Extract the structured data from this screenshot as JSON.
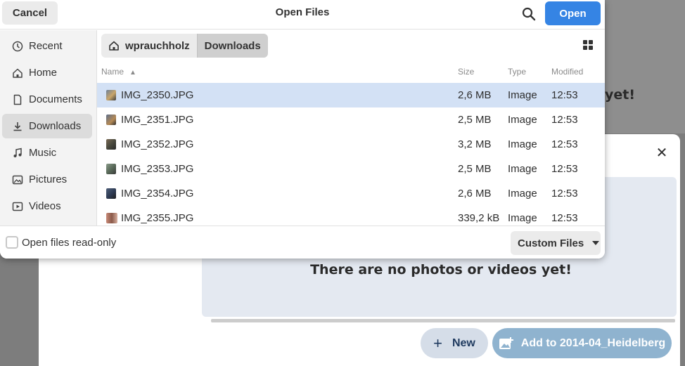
{
  "background_app": {
    "heading_fragment": "yet!",
    "empty_message": "There are no photos or videos yet!",
    "new_button_label": "New",
    "add_button_label": "Add to 2014-04_Heidelberg",
    "close_icon": "close-icon",
    "accent_color": "#8fb3cf"
  },
  "dialog": {
    "title": "Open Files",
    "cancel_label": "Cancel",
    "open_label": "Open",
    "search_icon": "search-icon",
    "accent_color": "#3584e4"
  },
  "sidebar": {
    "items": [
      {
        "label": "Recent",
        "icon": "clock-icon"
      },
      {
        "label": "Home",
        "icon": "home-icon"
      },
      {
        "label": "Documents",
        "icon": "document-icon"
      },
      {
        "label": "Downloads",
        "icon": "download-icon",
        "active": true
      },
      {
        "label": "Music",
        "icon": "music-icon"
      },
      {
        "label": "Pictures",
        "icon": "image-icon"
      },
      {
        "label": "Videos",
        "icon": "video-icon"
      }
    ]
  },
  "pathbar": {
    "home_label": "wprauchholz",
    "current_label": "Downloads",
    "view_toggle_icon": "grid-view-icon"
  },
  "columns": {
    "name": "Name",
    "size": "Size",
    "type": "Type",
    "modified": "Modified"
  },
  "files": [
    {
      "name": "IMG_2350.JPG",
      "size": "2,6 MB",
      "type": "Image",
      "modified": "12:53",
      "selected": true
    },
    {
      "name": "IMG_2351.JPG",
      "size": "2,5 MB",
      "type": "Image",
      "modified": "12:53"
    },
    {
      "name": "IMG_2352.JPG",
      "size": "3,2 MB",
      "type": "Image",
      "modified": "12:53"
    },
    {
      "name": "IMG_2353.JPG",
      "size": "2,5 MB",
      "type": "Image",
      "modified": "12:53"
    },
    {
      "name": "IMG_2354.JPG",
      "size": "2,6 MB",
      "type": "Image",
      "modified": "12:53"
    },
    {
      "name": "IMG_2355.JPG",
      "size": "339,2 kB",
      "type": "Image",
      "modified": "12:53"
    }
  ],
  "footer": {
    "read_only_label": "Open files read-only",
    "read_only_checked": false,
    "filter_label": "Custom Files"
  }
}
